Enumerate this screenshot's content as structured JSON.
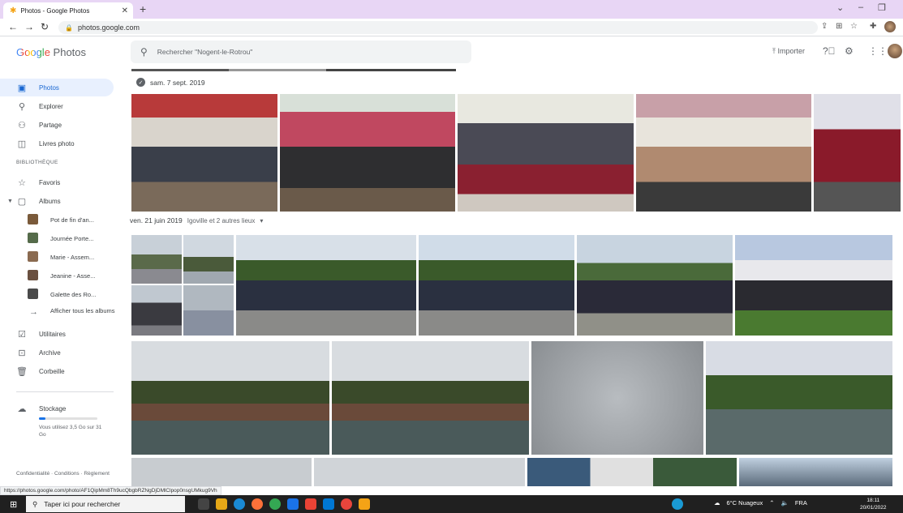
{
  "browser": {
    "tab_title": "Photos - Google Photos",
    "url": "photos.google.com",
    "status_url": "https://photos.google.com/photo/AF1QipMm8Th9ucQbgbRZNgDjDMlClpop0nsgUMkug9Vh"
  },
  "header": {
    "logo_google": "Google",
    "logo_photos": "Photos",
    "search_placeholder": "Rechercher \"Nogent-le-Rotrou\"",
    "import_label": "Importer"
  },
  "sidebar": {
    "items": [
      {
        "label": "Photos",
        "icon": "photo-icon"
      },
      {
        "label": "Explorer",
        "icon": "search-icon"
      },
      {
        "label": "Partage",
        "icon": "people-icon"
      },
      {
        "label": "Livres photo",
        "icon": "book-icon"
      }
    ],
    "section_library": "BIBLIOTHÈQUE",
    "library": [
      {
        "label": "Favoris",
        "icon": "star-icon"
      },
      {
        "label": "Albums",
        "icon": "album-icon"
      }
    ],
    "albums": [
      {
        "label": "Pot de fin d'an...",
        "color": "#7a5a3a"
      },
      {
        "label": "Journée Porte...",
        "color": "#556b4a"
      },
      {
        "label": "Marie - Assem...",
        "color": "#8a6a50"
      },
      {
        "label": "Jeanine - Asse...",
        "color": "#6a5040"
      },
      {
        "label": "Galette des Ro...",
        "color": "#4a4a4a"
      }
    ],
    "show_all": "Afficher tous les albums",
    "bottom": [
      {
        "label": "Utilitaires",
        "icon": "utilities-icon"
      },
      {
        "label": "Archive",
        "icon": "archive-icon"
      },
      {
        "label": "Corbeille",
        "icon": "trash-icon"
      }
    ],
    "storage_label": "Stockage",
    "storage_text": "Vous utilisez 3,5 Go sur 31 Go",
    "storage_fraction": 0.113,
    "footer_links": "Confidentialité · Conditions · Règlement"
  },
  "main": {
    "group1_date": "sam. 7 sept. 2019",
    "group2_date": "ven. 21 juin 2019",
    "group2_location": "Igoville et 2 autres lieux"
  },
  "taskbar": {
    "search_placeholder": "Taper ici pour rechercher",
    "weather": "6°C Nuageux",
    "lang": "FRA",
    "time": "18:11",
    "date": "20/01/2022"
  }
}
